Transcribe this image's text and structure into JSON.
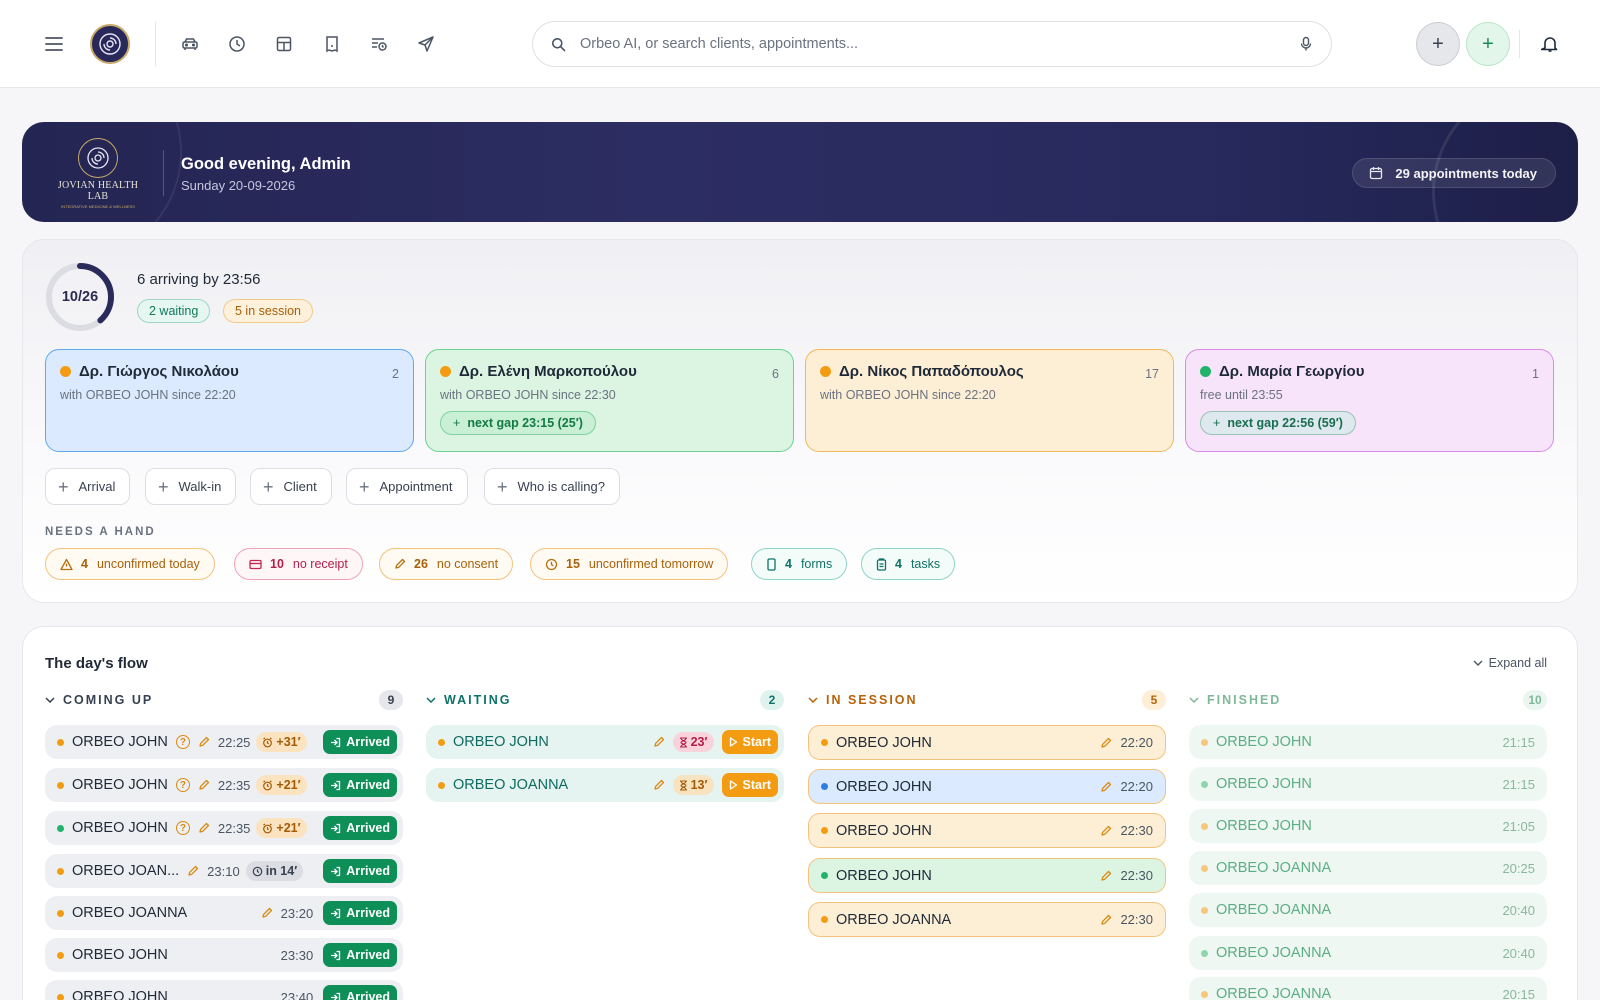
{
  "topbar": {
    "search_placeholder": "Orbeo AI, or search clients, appointments..."
  },
  "hero": {
    "brand": "JOVIAN HEALTH LAB",
    "tagline": "INTEGRATIVE MEDICINE & WELLNESS",
    "greeting": "Good evening, Admin",
    "date": "Sunday 20-09-2026",
    "appointments": "29 appointments today"
  },
  "overview": {
    "progress_label": "10/26",
    "progress_value": 0.385,
    "arriving": "6 arriving by 23:56",
    "waiting_pill": "2 waiting",
    "session_pill": "5 in session"
  },
  "doctors": [
    {
      "name": "Δρ. Γιώργος Νικολάου",
      "count": "2",
      "status": "with ORBEO JOHN since 22:20",
      "gap": ""
    },
    {
      "name": "Δρ. Ελένη Μαρκοπούλου",
      "count": "6",
      "status": "with ORBEO JOHN since 22:30",
      "gap": "next gap 23:15 (25′)"
    },
    {
      "name": "Δρ. Νίκος Παπαδόπουλος",
      "count": "17",
      "status": "with ORBEO JOHN since 22:20",
      "gap": ""
    },
    {
      "name": "Δρ. Μαρία Γεωργίου",
      "count": "1",
      "status": "free until 23:55",
      "gap": "next gap 22:56 (59′)"
    }
  ],
  "actions": [
    "Arrival",
    "Walk-in",
    "Client",
    "Appointment",
    "Who is calling?"
  ],
  "needs": {
    "heading": "NEEDS A HAND",
    "items": [
      {
        "count": "4",
        "label": "unconfirmed today"
      },
      {
        "count": "10",
        "label": "no receipt"
      },
      {
        "count": "26",
        "label": "no consent"
      },
      {
        "count": "15",
        "label": "unconfirmed tomorrow"
      },
      {
        "count": "4",
        "label": "forms"
      },
      {
        "count": "4",
        "label": "tasks"
      }
    ]
  },
  "flow": {
    "title": "The day's flow",
    "expand": "Expand all",
    "columns": [
      {
        "title": "COMING UP",
        "count": "9",
        "items": [
          {
            "name": "ORBEO JOHN",
            "time": "22:25",
            "late": "+31′",
            "action": "Arrived"
          },
          {
            "name": "ORBEO JOHN",
            "time": "22:35",
            "late": "+21′",
            "action": "Arrived"
          },
          {
            "name": "ORBEO JOHN",
            "time": "22:35",
            "late": "+21′",
            "action": "Arrived"
          },
          {
            "name": "ORBEO JOAN...",
            "time": "23:10",
            "late": "in 14′",
            "action": "Arrived"
          },
          {
            "name": "ORBEO JOANNA",
            "time": "23:20",
            "late": "",
            "action": "Arrived"
          },
          {
            "name": "ORBEO JOHN",
            "time": "23:30",
            "late": "",
            "action": "Arrived"
          },
          {
            "name": "ORBEO JOHN",
            "time": "23:40",
            "late": "",
            "action": "Arrived"
          }
        ]
      },
      {
        "title": "WAITING",
        "count": "2",
        "items": [
          {
            "name": "ORBEO JOHN",
            "wait": "23′",
            "action": "Start"
          },
          {
            "name": "ORBEO JOANNA",
            "wait": "13′",
            "action": "Start"
          }
        ]
      },
      {
        "title": "IN SESSION",
        "count": "5",
        "items": [
          {
            "name": "ORBEO JOHN",
            "time": "22:20"
          },
          {
            "name": "ORBEO JOHN",
            "time": "22:20"
          },
          {
            "name": "ORBEO JOHN",
            "time": "22:30"
          },
          {
            "name": "ORBEO JOHN",
            "time": "22:30"
          },
          {
            "name": "ORBEO JOANNA",
            "time": "22:30"
          }
        ]
      },
      {
        "title": "FINISHED",
        "count": "10",
        "items": [
          {
            "name": "ORBEO JOHN",
            "time": "21:15"
          },
          {
            "name": "ORBEO JOHN",
            "time": "21:15"
          },
          {
            "name": "ORBEO JOHN",
            "time": "21:05"
          },
          {
            "name": "ORBEO JOANNA",
            "time": "20:25"
          },
          {
            "name": "ORBEO JOANNA",
            "time": "20:40"
          },
          {
            "name": "ORBEO JOANNA",
            "time": "20:40"
          },
          {
            "name": "ORBEO JOANNA",
            "time": "20:15"
          }
        ]
      }
    ]
  },
  "colors": {
    "navy": "#26275a",
    "gold": "#c7a867",
    "green": "#0e8f57",
    "orange": "#f39c12",
    "blue_card": "#dbeafe",
    "green_card": "#dcf5e3",
    "orange_card": "#fdefd6",
    "purple_card": "#f7e4fb"
  },
  "icons": [
    "menu-icon",
    "logo-icon",
    "car-icon",
    "clock-icon",
    "layout-icon",
    "receipt-icon",
    "list-clock-icon",
    "send-icon",
    "search-icon",
    "mic-icon",
    "plus-icon",
    "bell-icon",
    "calendar-icon"
  ]
}
